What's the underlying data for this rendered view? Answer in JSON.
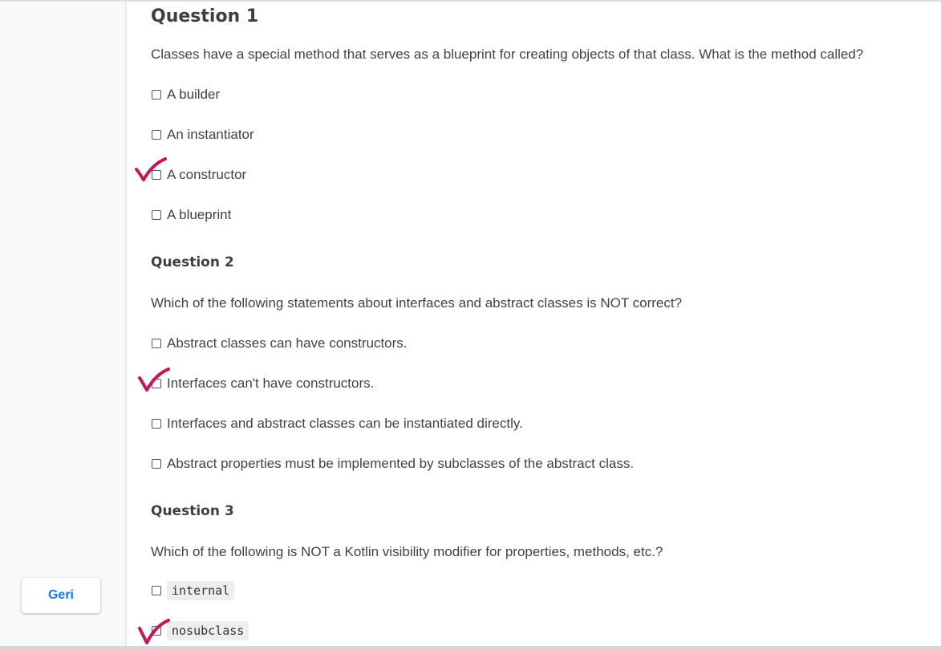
{
  "back_button": {
    "label": "Geri"
  },
  "colors": {
    "check_mark": "#c2185b",
    "link_blue": "#1a73e8"
  },
  "questions": [
    {
      "title": "Question 1",
      "text": "Classes have a special method that serves as a blueprint for creating objects of that class. What is the method called?",
      "options": [
        {
          "label": "A builder",
          "checked": false
        },
        {
          "label": "An instantiator",
          "checked": false
        },
        {
          "label": "A constructor",
          "checked": true
        },
        {
          "label": "A blueprint",
          "checked": false
        }
      ]
    },
    {
      "title": "Question 2",
      "text": "Which of the following statements about interfaces and abstract classes is NOT correct?",
      "options": [
        {
          "label": "Abstract classes can have constructors.",
          "checked": false
        },
        {
          "label": "Interfaces can't have constructors.",
          "checked": true
        },
        {
          "label": "Interfaces and abstract classes can be instantiated directly.",
          "checked": false
        },
        {
          "label": "Abstract properties must be implemented by subclasses of the abstract class.",
          "checked": false
        }
      ]
    },
    {
      "title": "Question 3",
      "text": "Which of the following is NOT a Kotlin visibility modifier for properties, methods, etc.?",
      "options": [
        {
          "label": "internal",
          "checked": false
        },
        {
          "label": "nosubclass",
          "checked": true
        }
      ]
    }
  ]
}
